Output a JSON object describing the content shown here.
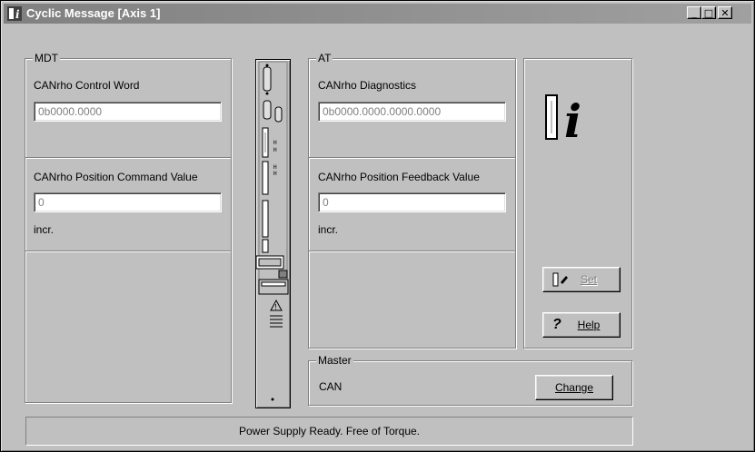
{
  "window": {
    "title": "Cyclic Message [Axis 1]",
    "buttons": {
      "minimize": "_",
      "maximize": "□",
      "close": "✕"
    }
  },
  "mdt": {
    "group_title": "MDT",
    "control_word_label": "CANrho Control Word",
    "control_word_value": "0b0000.0000",
    "position_command_label": "CANrho Position Command Value",
    "position_command_value": "0",
    "unit": "incr."
  },
  "at": {
    "group_title": "AT",
    "diagnostics_label": "CANrho Diagnostics",
    "diagnostics_value": "0b0000.0000.0000.0000",
    "position_feedback_label": "CANrho Position Feedback Value",
    "position_feedback_value": "0",
    "unit": "incr."
  },
  "info_panel": {
    "icon": "drive-info-icon",
    "set_button": "Set",
    "help_button": "Help"
  },
  "master": {
    "group_title": "Master",
    "value": "CAN",
    "change_button": "Change"
  },
  "status": {
    "text": "Power Supply Ready. Free of Torque."
  },
  "colors": {
    "face": "#c0c0c0",
    "shadow": "#808080",
    "highlight": "#ffffff",
    "disabled_text": "#808080",
    "titlebar_inactive": "#808080"
  }
}
